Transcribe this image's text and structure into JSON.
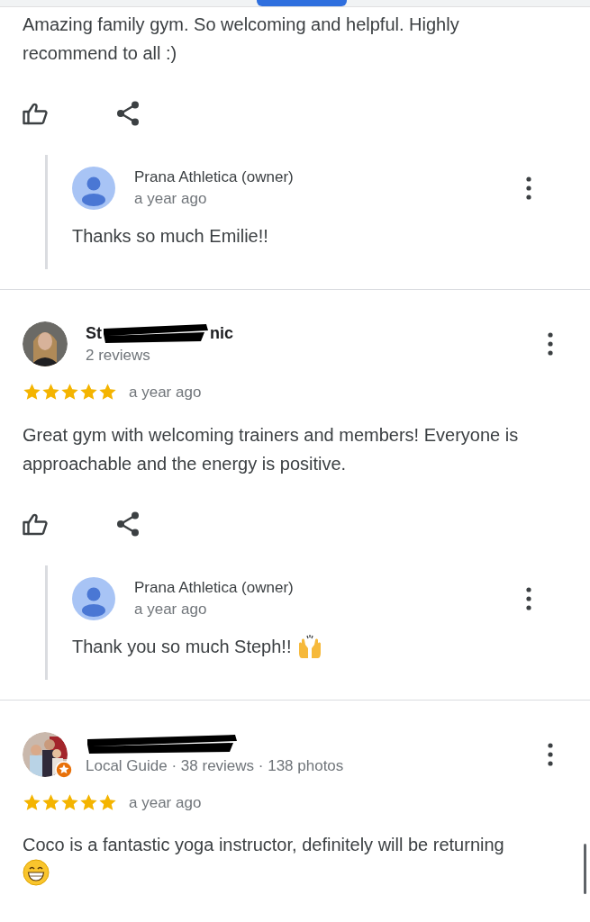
{
  "reviews": [
    {
      "text": "Amazing family gym. So welcoming and helpful. Highly recommend to all :)",
      "actions": true,
      "reply": {
        "author": "Prana Athletica (owner)",
        "time": "a year ago",
        "text": "Thanks so much Emilie!!"
      }
    },
    {
      "author": {
        "name_parts": [
          "St",
          "nic"
        ],
        "redacted": true,
        "local_guide": false
      },
      "meta": "2 reviews",
      "stars": 5,
      "time": "a year ago",
      "text": "Great gym with welcoming trainers and members! Everyone is approachable and the energy is positive.",
      "actions": true,
      "reply": {
        "author": "Prana Athletica (owner)",
        "time": "a year ago",
        "text": "Thank you so much Steph!!",
        "kind": "celebrate"
      }
    },
    {
      "author": {
        "redacted": true,
        "local_guide": true
      },
      "meta": "Local Guide · 38 reviews · 138 photos",
      "stars": 5,
      "time": "a year ago",
      "text": "Coco is a fantastic yoga instructor, definitely will be returning",
      "kind": "happy",
      "actions": false
    }
  ]
}
